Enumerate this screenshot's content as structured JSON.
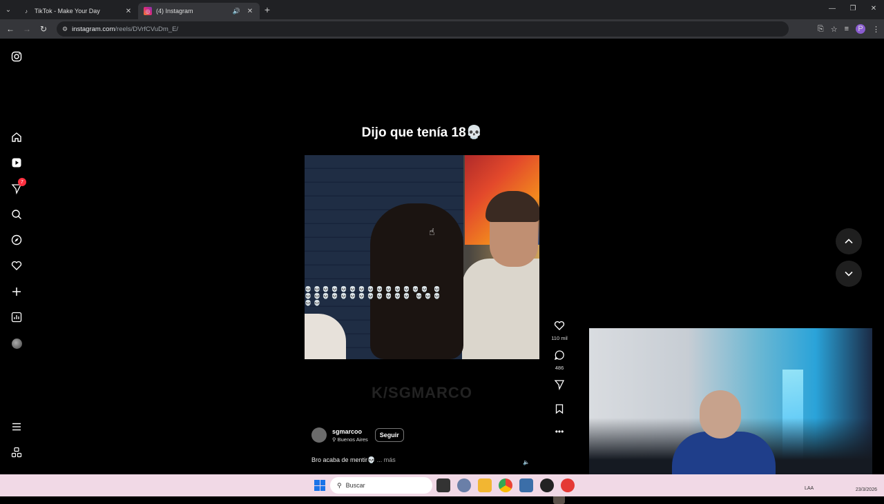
{
  "browser": {
    "tabs": [
      {
        "title": "TikTok - Make Your Day",
        "favicon": "tiktok-icon",
        "active": false
      },
      {
        "title": "(4) Instagram",
        "favicon": "instagram-icon",
        "active": true
      }
    ],
    "url_host": "instagram.com",
    "url_path": "/reels/DVrfCVuDm_E/",
    "profile_initial": "P"
  },
  "sidebar": {
    "notification_count": "7",
    "items": [
      "instagram-logo-icon",
      "home-icon",
      "reels-icon",
      "messages-icon",
      "search-icon",
      "explore-icon",
      "heart-icon",
      "create-icon",
      "dashboard-icon",
      "profile-avatar",
      "menu-icon",
      "more-icon"
    ]
  },
  "reel": {
    "overlay_text": "Dijo que tenía 18💀",
    "skulls_row": "💀💀💀💀💀💀💀💀💀💀💀💀💀💀 💀💀💀💀💀💀💀💀💀💀💀💀💀 💀💀💀💀💀",
    "watermark": "K/SGMARCO",
    "author": "sgmarcoo",
    "location": "Buenos Aires",
    "follow_label": "Seguir",
    "description": "Bro acaba de mentir💀",
    "more_label": "... más"
  },
  "actions": {
    "likes": "110 mil",
    "comments": "486"
  },
  "taskbar": {
    "search_placeholder": "Buscar",
    "lang": "LAA",
    "date": "23/3/2026"
  },
  "colors": {
    "background": "#000000",
    "badge": "#ff3040",
    "profile": "#8a5cd0"
  }
}
